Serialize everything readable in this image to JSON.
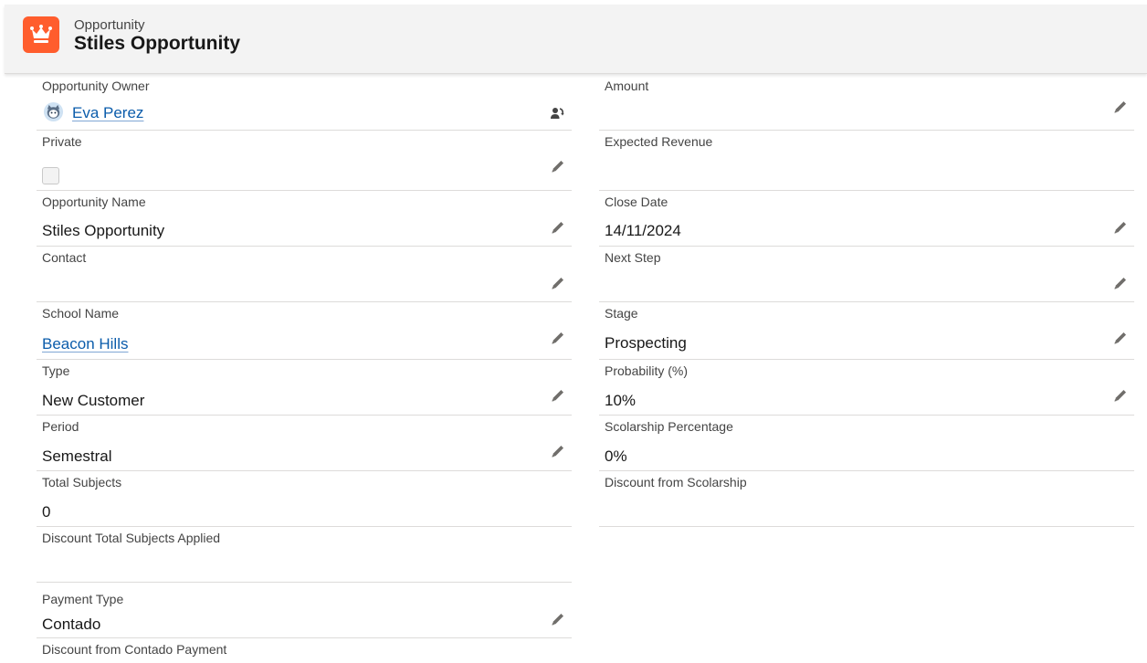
{
  "header": {
    "object_label": "Opportunity",
    "record_title": "Stiles Opportunity"
  },
  "colors": {
    "brand_icon": "#ff5d2d",
    "link": "#0b5cab",
    "label": "#444444",
    "divider": "#dddbda"
  },
  "left": {
    "owner": {
      "label": "Opportunity Owner",
      "value": "Eva Perez"
    },
    "private": {
      "label": "Private",
      "checked": false
    },
    "opportunity_name": {
      "label": "Opportunity Name",
      "value": "Stiles Opportunity"
    },
    "contact": {
      "label": "Contact",
      "value": ""
    },
    "school_name": {
      "label": "School Name",
      "value": "Beacon Hills"
    },
    "type": {
      "label": "Type",
      "value": "New Customer"
    },
    "period": {
      "label": "Period",
      "value": "Semestral"
    },
    "total_subjects": {
      "label": "Total Subjects",
      "value": "0"
    },
    "discount_total_subjects": {
      "label": "Discount Total Subjects Applied",
      "value": ""
    },
    "payment_type": {
      "label": "Payment Type",
      "value": "Contado"
    },
    "discount_contado": {
      "label": "Discount from Contado Payment",
      "value": ""
    }
  },
  "right": {
    "amount": {
      "label": "Amount",
      "value": ""
    },
    "expected_revenue": {
      "label": "Expected Revenue",
      "value": ""
    },
    "close_date": {
      "label": "Close Date",
      "value": "14/11/2024"
    },
    "next_step": {
      "label": "Next Step",
      "value": ""
    },
    "stage": {
      "label": "Stage",
      "value": "Prospecting"
    },
    "probability": {
      "label": "Probability (%)",
      "value": "10%"
    },
    "scolarship_percentage": {
      "label": "Scolarship Percentage",
      "value": "0%"
    },
    "discount_scolarship": {
      "label": "Discount from Scolarship",
      "value": ""
    }
  },
  "icons": {
    "record_icon": "crown-icon",
    "edit": "pencil-icon",
    "change_owner": "change-owner-icon",
    "owner_avatar": "astro-avatar-icon"
  }
}
